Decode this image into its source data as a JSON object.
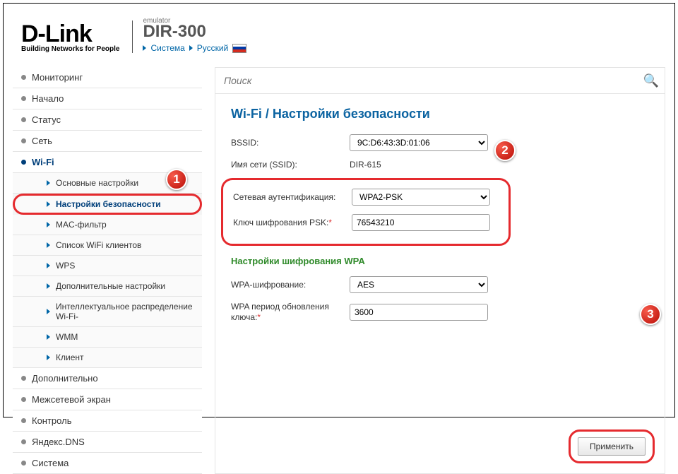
{
  "header": {
    "brand": "D-Link",
    "tagline": "Building Networks for People",
    "emulator": "emulator",
    "model": "DIR-300",
    "crumb1": "Система",
    "crumb2": "Русский"
  },
  "search": {
    "placeholder": "Поиск"
  },
  "sidebar": {
    "items": [
      {
        "label": "Мониторинг"
      },
      {
        "label": "Начало"
      },
      {
        "label": "Статус"
      },
      {
        "label": "Сеть"
      },
      {
        "label": "Wi-Fi",
        "expanded": true
      },
      {
        "label": "Дополнительно"
      },
      {
        "label": "Межсетевой экран"
      },
      {
        "label": "Контроль"
      },
      {
        "label": "Яндекс.DNS"
      },
      {
        "label": "Система"
      }
    ],
    "wifi_sub": [
      {
        "label": "Основные настройки"
      },
      {
        "label": "Настройки безопасности",
        "active": true
      },
      {
        "label": "MAC-фильтр"
      },
      {
        "label": "Список WiFi клиентов"
      },
      {
        "label": "WPS"
      },
      {
        "label": "Дополнительные настройки"
      },
      {
        "label": "Интеллектуальное распределение Wi-Fi-"
      },
      {
        "label": "WMM"
      },
      {
        "label": "Клиент"
      }
    ]
  },
  "main": {
    "title": "Wi-Fi /  Настройки безопасности",
    "bssid_label": "BSSID:",
    "bssid_value": "9C:D6:43:3D:01:06",
    "ssid_label": "Имя сети (SSID):",
    "ssid_value": "DIR-615",
    "auth_label": "Сетевая аутентификация:",
    "auth_value": "WPA2-PSK",
    "psk_label": "Ключ шифрования PSK:",
    "psk_value": "76543210",
    "wpa_section": "Настройки шифрования WPA",
    "wpa_enc_label": "WPA-шифрование:",
    "wpa_enc_value": "AES",
    "wpa_period_label": "WPA период обновления ключа:",
    "wpa_period_value": "3600",
    "apply": "Применить"
  },
  "badges": {
    "b1": "1",
    "b2": "2",
    "b3": "3"
  }
}
